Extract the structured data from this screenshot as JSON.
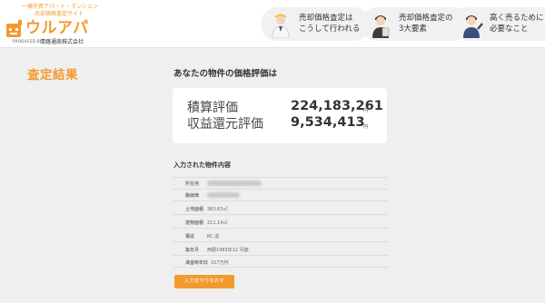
{
  "header": {
    "tagline": "一棟売買アパート・マンション\n売却価格査定サイト",
    "brand": "ウルアパ",
    "produced_by": "PRODUCED BY",
    "company": "清薩通商株式会社",
    "nav": [
      {
        "text": "売却価格査定は\nこうして行われる"
      },
      {
        "text": "売却価格査定の\n3大要素"
      },
      {
        "text": "高く売るために\n必要なこと"
      }
    ]
  },
  "sidebar": {
    "title": "査定結果"
  },
  "main": {
    "result_heading": "あなたの物件の価格評価は",
    "valuation": [
      {
        "label": "積算評価",
        "value": "224,183,261",
        "unit": "円"
      },
      {
        "label": "収益還元評価",
        "value": "9,534,413",
        "unit": "円"
      }
    ],
    "entered_heading": "入力された物件内容",
    "property_rows": [
      {
        "label": "所在地",
        "value": ""
      },
      {
        "label": "路線価",
        "value": ""
      },
      {
        "label": "土地面積",
        "value": "363.63㎡"
      },
      {
        "label": "建物面積",
        "value": "211.14㎡"
      },
      {
        "label": "構造",
        "value": "RC 造"
      },
      {
        "label": "築年月",
        "value": "西暦1983年12 月築"
      },
      {
        "label": "満室時年収",
        "value": "157万円"
      }
    ],
    "redo_button": "入力をやりなおす"
  },
  "colors": {
    "accent": "#f29a2e",
    "background": "#efefef",
    "card": "#ffffff"
  }
}
